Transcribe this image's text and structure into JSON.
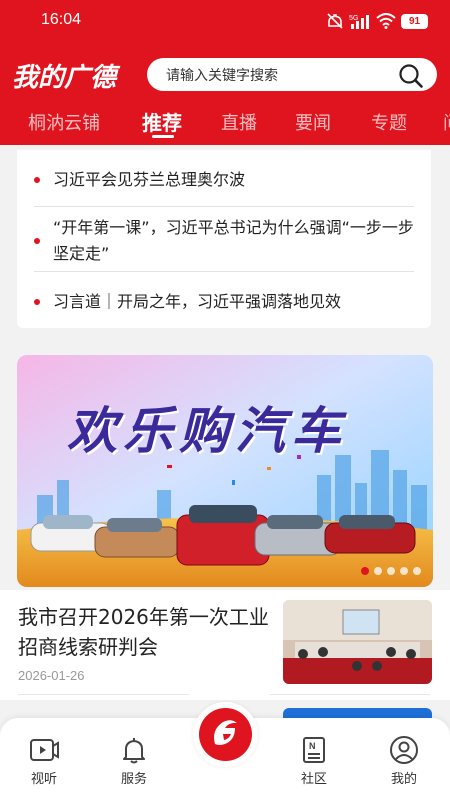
{
  "status": {
    "time": "16:04",
    "battery": "91",
    "network": "5G"
  },
  "header": {
    "logo": "我的广德",
    "search_placeholder": "请输入关键字搜索"
  },
  "tabs": [
    {
      "label": "桐汭云铺"
    },
    {
      "label": "推荐"
    },
    {
      "label": "直播"
    },
    {
      "label": "要闻"
    },
    {
      "label": "专题"
    },
    {
      "label": "问"
    }
  ],
  "headlines": [
    {
      "text": "习近平会见芬兰总理奥尔波"
    },
    {
      "text": "“开年第一课”，习近平总书记为什么强调“一步一步坚定走”"
    },
    {
      "text": "习言道｜开局之年，习近平强调落地见效"
    }
  ],
  "banner": {
    "title": "欢乐购汽车",
    "slide_count": 5,
    "active_slide": 1
  },
  "article": {
    "title": "我市召开2026年第一次工业招商线索研判会",
    "date": "2026-01-26"
  },
  "bottom_nav": [
    {
      "label": "视听",
      "icon": "video-icon"
    },
    {
      "label": "服务",
      "icon": "bell-icon"
    },
    {
      "label": "",
      "icon": "logo-home-icon"
    },
    {
      "label": "社区",
      "icon": "document-icon"
    },
    {
      "label": "我的",
      "icon": "user-icon"
    }
  ],
  "colors": {
    "brand": "#e0141e",
    "text": "#222222",
    "muted": "#999999"
  }
}
